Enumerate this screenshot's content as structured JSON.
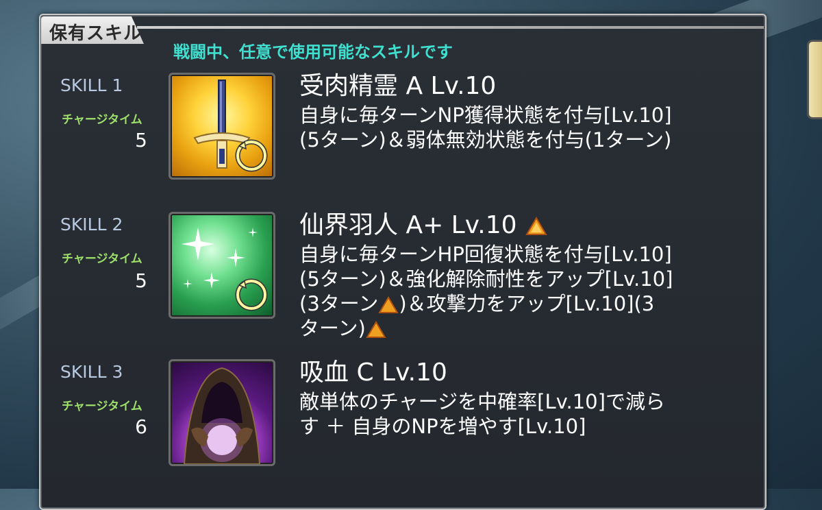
{
  "header": {
    "title": "保有スキル",
    "subtitle": "戦闘中、任意で使用可能なスキルです"
  },
  "charge_label": "チャージタイム",
  "skills": [
    {
      "number": "SKILL 1",
      "charge": "5",
      "name": "受肉精霊 A Lv.10",
      "icon": "sword-icon",
      "desc": [
        "自身に毎ターンNP獲得状態を付与[Lv.10]",
        "(5ターン)＆弱体無効状態を付与(1ターン)"
      ]
    },
    {
      "number": "SKILL 2",
      "charge": "5",
      "name": "仙界羽人 A+ Lv.10",
      "icon": "sparkle-icon",
      "desc": [
        "自身に毎ターンHP回復状態を付与[Lv.10]",
        "(5ターン)＆強化解除耐性をアップ[Lv.10]",
        "(3ターン",
        ")＆攻撃力をアップ[Lv.10](3",
        "ターン)"
      ]
    },
    {
      "number": "SKILL 3",
      "charge": "6",
      "name": "吸血 C Lv.10",
      "icon": "vampire-hood-icon",
      "desc": [
        "敵単体のチャージを中確率[Lv.10]で減ら",
        "す ＋ 自身のNPを増やす[Lv.10]"
      ]
    }
  ],
  "colors": {
    "subtitle": "#40e0d0",
    "charge_label": "#9ee06a",
    "upgrade_arrow": "#f0a020"
  }
}
